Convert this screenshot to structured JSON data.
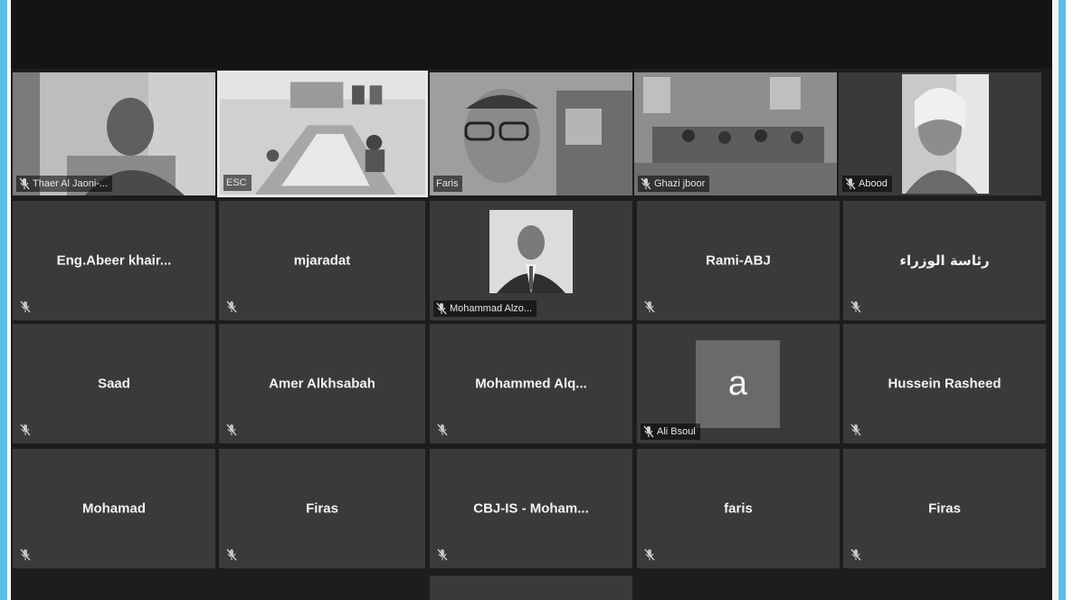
{
  "participants": {
    "row1": [
      {
        "name": "Thaer Al Jaoni-..."
      },
      {
        "name": "ESC"
      },
      {
        "name": "Faris"
      },
      {
        "name": "Ghazi jboor"
      },
      {
        "name": "Abood"
      }
    ],
    "row2": [
      {
        "name": "Eng.Abeer  khair..."
      },
      {
        "name": "mjaradat"
      },
      {
        "name": "Mohammad Alzo..."
      },
      {
        "name": "Rami-ABJ"
      },
      {
        "name": "رئاسة الوزراء"
      }
    ],
    "row3": [
      {
        "name": "Saad"
      },
      {
        "name": "Amer Alkhsabah"
      },
      {
        "name": "Mohammed  Alq..."
      },
      {
        "name": "Ali Bsoul",
        "avatar_letter": "a"
      },
      {
        "name": "Hussein Rasheed"
      }
    ],
    "row4": [
      {
        "name": "Mohamad"
      },
      {
        "name": "Firas"
      },
      {
        "name": "CBJ-IS - Moham..."
      },
      {
        "name": "faris"
      },
      {
        "name": "Firas"
      }
    ]
  },
  "colors": {
    "accent_border": "#5bbfe6",
    "tile_bg": "#3a3a3a",
    "window_bg": "#1d1d1d"
  },
  "icons": {
    "muted": "mic-muted-icon"
  }
}
